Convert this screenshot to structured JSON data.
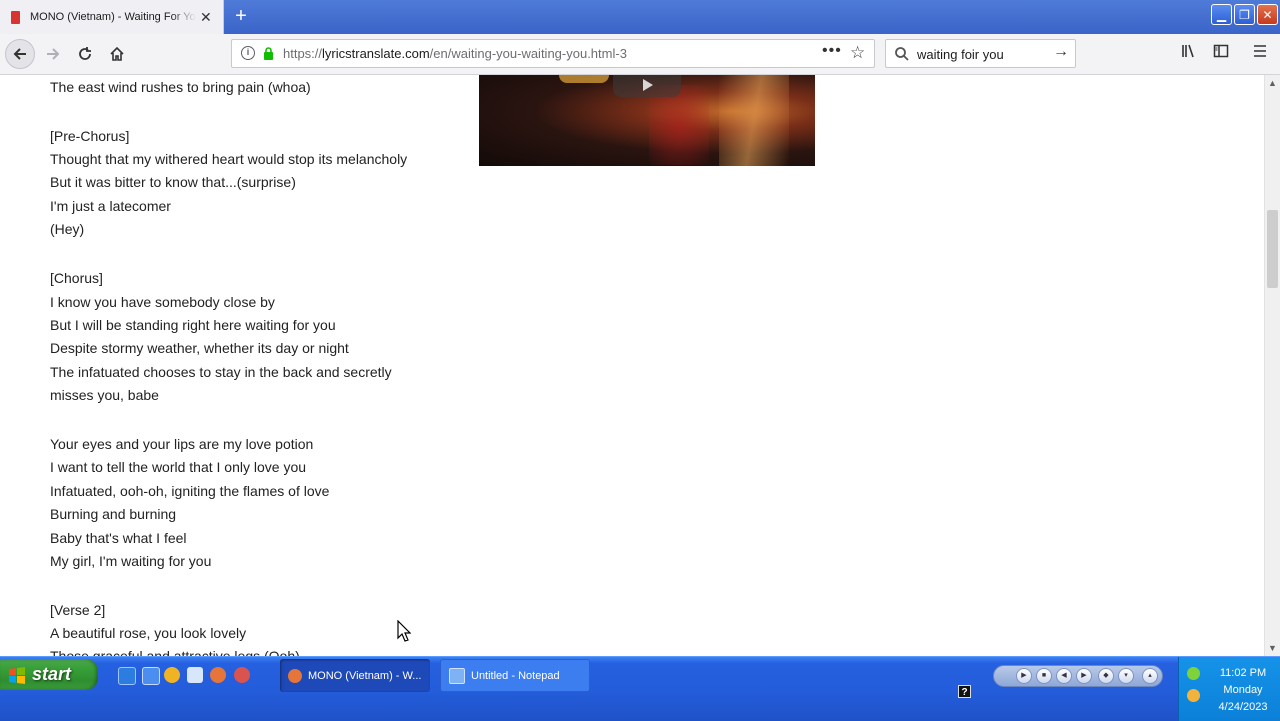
{
  "browser": {
    "tab_title": "MONO (Vietnam) - Waiting For You",
    "tab_close": "✕",
    "new_tab": "+",
    "url_prefix": "https://",
    "url_domain": "lyricstranslate.com",
    "url_path": "/en/waiting-you-waiting-you.html-3",
    "url_more": "•••",
    "search_value": "waiting foir you",
    "window_buttons": {
      "minimize": "▁",
      "restore": "❐",
      "close": "✕"
    }
  },
  "lyrics": [
    "The east wind rushes to bring pain (whoa)",
    "[Pre-Chorus]",
    "Thought that my withered heart would stop its melancholy",
    "But it was bitter to know that...(surprise)",
    "I'm just a latecomer",
    "(Hey)",
    "[Chorus]",
    "I know you have somebody close by",
    "But I will be standing right here waiting for you",
    "Despite stormy weather, whether its day or night",
    "The infatuated chooses to stay in the back and secretly",
    "misses you, babe",
    "Your eyes and your lips are my love potion",
    "I want to tell the world that I only love you",
    "Infatuated, ooh-oh, igniting the flames of love",
    "Burning and burning",
    "Baby that's what I feel",
    "My girl, I'm waiting for you",
    "[Verse 2]",
    "A beautiful rose, you look lovely",
    "Those graceful and attractive legs (Ooh)"
  ],
  "taskbar": {
    "start_label": "start",
    "tasks": [
      {
        "label": "MONO (Vietnam) - W..."
      },
      {
        "label": "Untitled - Notepad"
      }
    ],
    "help": "?",
    "clock": {
      "time": "11:02 PM",
      "day": "Monday",
      "date": "4/24/2023"
    }
  },
  "colors": {
    "accent": "#245ddb",
    "start_green": "#38a038",
    "tray_blue": "#0c80d8",
    "tab_favicon": "#d6362f"
  }
}
